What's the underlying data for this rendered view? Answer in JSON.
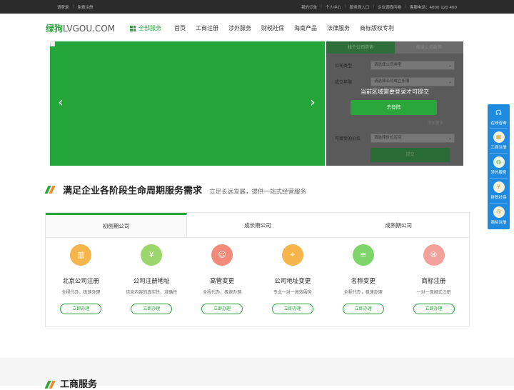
{
  "topbar": {
    "login": "请登录",
    "register": "免费注册",
    "links": [
      "我的订单",
      "个人中心",
      "服务商入口",
      "企业调查问卷",
      "客服电话：4000 120 460"
    ]
  },
  "header": {
    "logo_cn": "绿狗",
    "logo_en": "LVGOU.COM",
    "all_services": "全部服务",
    "nav": [
      "首页",
      "工商注册",
      "涉外服务",
      "财税社保",
      "海南产品",
      "法律服务",
      "商标版权专利"
    ]
  },
  "banner": {
    "prev": "‹",
    "next": "›",
    "color": "#25a63b"
  },
  "sideform": {
    "tabs": [
      "找个公司咨询",
      "解读公司政策"
    ],
    "fields": [
      {
        "label": "公司类型",
        "value": "请选择公司类型"
      },
      {
        "label": "成立年限",
        "value": "请选择公司成立年限"
      },
      {
        "label": "可接受的价位",
        "value": "请选择价位区间"
      }
    ],
    "mask_text": "当前区域需要登录才可提交",
    "login_btn": "去登陆",
    "faint": "添加更多",
    "submit": "提交"
  },
  "floatbar": {
    "items": [
      "在线咨询",
      "工商注册",
      "涉外服务",
      "财税社保",
      "商标注册"
    ]
  },
  "lifecycle": {
    "title": "满足企业各阶段生命周期服务需求",
    "subtitle": "立足长远发展，提供一站式经营服务",
    "tabs": [
      "初创期公司",
      "成长期公司",
      "成熟期公司"
    ],
    "services": [
      {
        "name": "北京公司注册",
        "desc": "全程代办，极速办理",
        "btn": "立即办理",
        "color": "#f5b54a"
      },
      {
        "name": "公司注册地址",
        "desc": "信息内容的真实性、准确性",
        "btn": "立即办理",
        "color": "#9ad66b"
      },
      {
        "name": "高管变更",
        "desc": "全程代办，极速办理",
        "btn": "立即办理",
        "color": "#f28a7a"
      },
      {
        "name": "公司地址变更",
        "desc": "专业一对一高效服务",
        "btn": "立即办理",
        "color": "#f5b54a"
      },
      {
        "name": "名称变更",
        "desc": "全程代办，极速办理",
        "btn": "立即办理",
        "color": "#7ed66b"
      },
      {
        "name": "商标注册",
        "desc": "一对一保姆式注册",
        "btn": "立即办理",
        "color": "#f2a29a"
      }
    ]
  },
  "section2": {
    "title": "工商服务"
  }
}
